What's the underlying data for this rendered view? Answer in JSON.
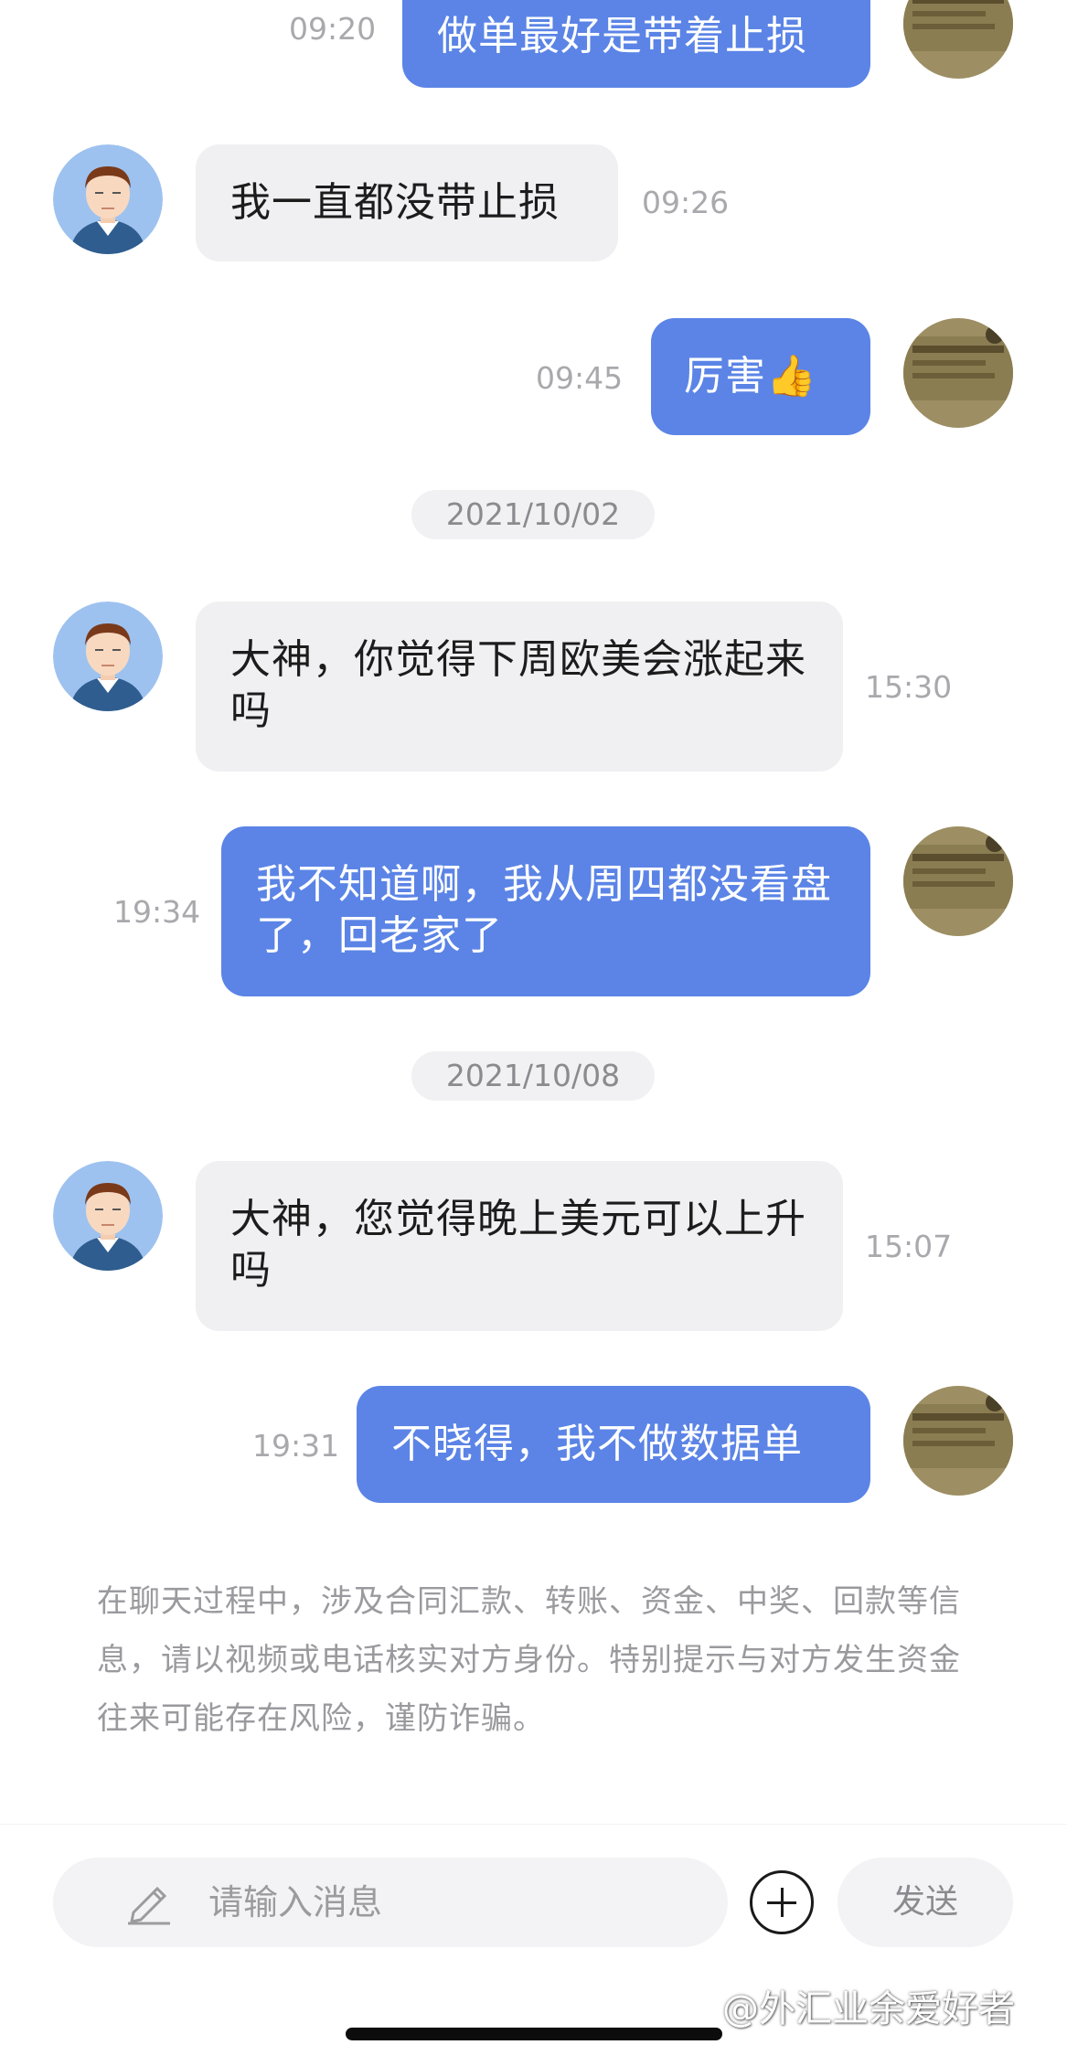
{
  "messages": [
    {
      "side": "out",
      "text": "做单最好是带着止损",
      "time": "09:20"
    },
    {
      "side": "in",
      "text": "我一直都没带止损",
      "time": "09:26"
    },
    {
      "side": "out",
      "text": "厉害👍",
      "time": "09:45"
    },
    {
      "side": "in",
      "text": "大神，你觉得下周欧美会涨起来吗",
      "time": "15:30"
    },
    {
      "side": "out",
      "text": "我不知道啊，我从周四都没看盘了，回老家了",
      "time": "19:34"
    },
    {
      "side": "in",
      "text": "大神，您觉得晚上美元可以上升吗",
      "time": "15:07"
    },
    {
      "side": "out",
      "text": "不晓得，我不做数据单",
      "time": "19:31"
    }
  ],
  "dates": [
    "2021/10/02",
    "2021/10/08"
  ],
  "warning": "在聊天过程中，涉及合同汇款、转账、资金、中奖、回款等信息，请以视频或电话核实对方身份。特别提示与对方发生资金往来可能存在风险，谨防诈骗。",
  "input": {
    "placeholder": "请输入消息",
    "send_label": "发送"
  },
  "watermark": "@外汇业余爱好者",
  "colors": {
    "outgoing_bubble": "#5b84e6",
    "incoming_bubble": "#f0f0f2",
    "background": "#ffffff"
  }
}
